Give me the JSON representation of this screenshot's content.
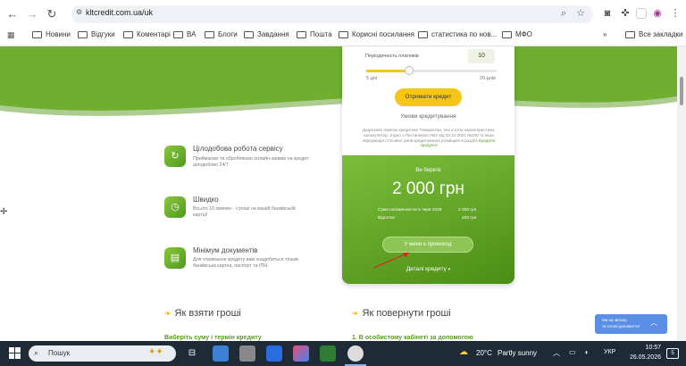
{
  "browser": {
    "url": "kltcredit.com.ua/uk",
    "bookmarks": [
      "Новини",
      "Відгуки",
      "Коментарі",
      "ВА",
      "Блоги",
      "Завдання",
      "Пошта",
      "Корисні посилання",
      "статистика по нов...",
      "МФО"
    ],
    "all_bookmarks": "Все закладки",
    "more": "»"
  },
  "calculator": {
    "frequency_label": "Періодичність платежів",
    "frequency_value": "10",
    "slider_min": "5 дні",
    "slider_max": "20 днів",
    "slider_fraction": 0.33,
    "get_credit_button": "Отримати кредит",
    "conditions_link": "Умови кредитування",
    "disclaimer_text": "Додатково перелік кредитних Товариства, їхні істотні характеристики, калькулятор, згідно з Постановою НБУ від 03.10.2021 №100 та інша інформація стосовно умов кредитування розміщені в розділі",
    "disclaimer_link": "Кредитні продукти",
    "you_take_label": "Ви берете",
    "amount": "2 000 грн",
    "repay_label": "Сума погашення на 5 черв 2026",
    "repay_value": "2 200 грн",
    "interest_label": "Відсотки",
    "interest_value": "200 грн",
    "promo_button": "У мене є промокод",
    "details_link": "Деталі кредиту"
  },
  "features": [
    {
      "title": "Цілодобова робота сервісу",
      "desc": "Приймаємо та обробляємо онлайн-заявки на кредит цілодобово 24/7."
    },
    {
      "title": "Швидко",
      "desc": "Всього 10 хвилин - і гроші на вашій банківській картці!"
    },
    {
      "title": "Мінімум документів",
      "desc": "Для отримання кредиту вам знадобиться тільки банківська картка, паспорт та ІПН."
    }
  ],
  "sections": {
    "how_get": "Як взяти гроші",
    "how_return": "Як повернути гроші",
    "step_get_1": "Виберіть суму і термін кредиту",
    "step_return_1": "1. В особистому кабінеті за допомогою"
  },
  "chat_widget": {
    "line1": "Ми на зв'язку",
    "line2": "та готові допомогти!"
  },
  "taskbar": {
    "search_placeholder": "Пошук",
    "weather_temp": "20°C",
    "weather_text": "Partly sunny",
    "lang": "УКР",
    "time": "10:57",
    "date": "26.05.2026",
    "notif_count": "5"
  },
  "colors": {
    "brand_green": "#6aaa2a",
    "accent_yellow": "#f5c518",
    "chat_blue": "#5b8ee6"
  }
}
